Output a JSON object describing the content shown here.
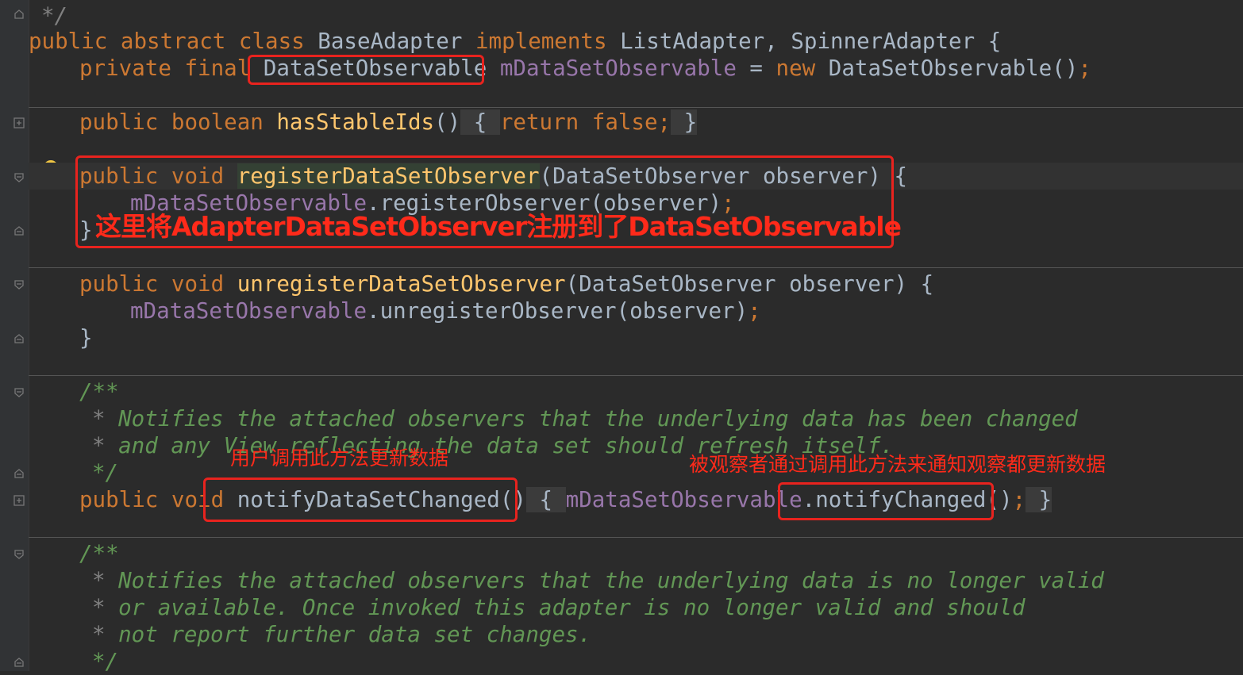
{
  "editor": {
    "lines": {
      "l1": {
        "cm": "*/"
      },
      "l2": {
        "kw1": "public",
        "kw2": "abstract",
        "kw3": "class",
        "cls": "BaseAdapter",
        "kw4": "implements",
        "ifaces": "ListAdapter, SpinnerAdapter {"
      },
      "l3": {
        "kw1": "private",
        "kw2": "final",
        "type": "DataSetObservable",
        "field": "mDataSetObservable",
        "eq": " = ",
        "kw3": "new",
        "ctor": "DataSetObservable()",
        "semi": ";"
      },
      "l4": {
        "kw1": "public",
        "kw2": "boolean",
        "fn": "hasStableIds",
        "paren": "()",
        "ob": " { ",
        "kw3": "return",
        "kw4": "false;",
        "cb": " }"
      },
      "l5": {
        "kw1": "public",
        "kw2": "void",
        "fn": "registerDataSetObserver",
        "params": "(DataSetObserver observer) {"
      },
      "l6": {
        "field": "mDataSetObservable",
        "call": ".registerObserver(observer)",
        "semi": ";"
      },
      "l7": {
        "brace": "}"
      },
      "l8": {
        "kw1": "public",
        "kw2": "void",
        "fn": "unregisterDataSetObserver",
        "params": "(DataSetObserver observer) {"
      },
      "l9": {
        "field": "mDataSetObservable",
        "call": ".unregisterObserver(observer)",
        "semi": ";"
      },
      "l10": {
        "brace": "}"
      },
      "l11": {
        "cm": "/**"
      },
      "l12": {
        "star": "*",
        "cm": " Notifies the attached observers that the underlying data has been changed"
      },
      "l13": {
        "star": "*",
        "cm": " and any View reflecting the data set should refresh itself."
      },
      "l14": {
        "cm": "*/"
      },
      "l15": {
        "kw1": "public",
        "kw2": "void",
        "fn": "notifyDataSetChanged",
        "paren": "()",
        "ob": " { ",
        "field": "mDataSetObservable",
        "call": ".notifyChanged()",
        "semi": ";",
        "cb": " }"
      },
      "l16": {
        "cm": "/**"
      },
      "l17": {
        "star": "*",
        "cm": " Notifies the attached observers that the underlying data is no longer valid"
      },
      "l18": {
        "star": "*",
        "cm": " or available. Once invoked this adapter is no longer valid and should"
      },
      "l19": {
        "star": "*",
        "cm": " not report further data set changes."
      },
      "l20": {
        "cm": "*/"
      }
    }
  },
  "annotations": {
    "register_note": "这里将AdapterDataSetObserver注册到了DataSetObservable",
    "user_call_note": "用户调用此方法更新数据",
    "observable_note": "被观察者通过调用此方法来通知观察都更新数据"
  },
  "colors": {
    "background": "#2b2b2b",
    "keyword": "#cc7832",
    "field": "#9876aa",
    "function": "#ffc66d",
    "comment": "#629755",
    "annotation_red": "#e8231e"
  },
  "icons": [
    "fold-collapse-icon",
    "fold-expand-icon",
    "lightbulb-icon"
  ]
}
